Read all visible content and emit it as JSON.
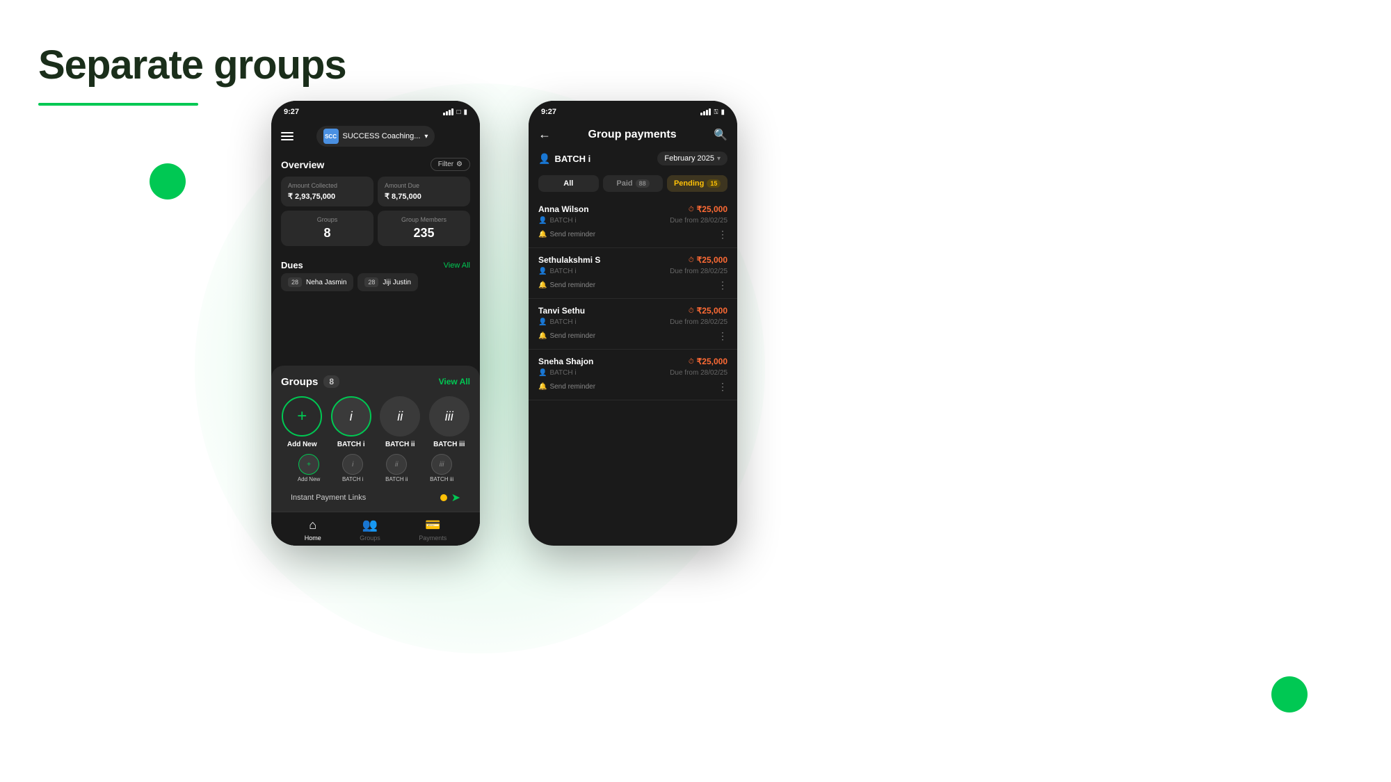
{
  "page": {
    "title": "Separate groups",
    "underline_color": "#00c853"
  },
  "left_phone": {
    "status_time": "9:27",
    "brand_name": "SUCCESS Coaching...",
    "brand_initials": "SCC",
    "header": {
      "filter_label": "Filter"
    },
    "overview": {
      "title": "Overview",
      "amount_collected_label": "Amount Collected",
      "amount_collected_value": "₹ 2,93,75,000",
      "amount_due_label": "Amount Due",
      "amount_due_value": "₹ 8,75,000",
      "groups_label": "Groups",
      "groups_value": "8",
      "members_label": "Group Members",
      "members_value": "235"
    },
    "dues": {
      "title": "Dues",
      "view_all": "View All",
      "items": [
        {
          "badge": "28",
          "name": "Neha Jasmin"
        },
        {
          "badge": "28",
          "name": "Jiji Justin"
        }
      ]
    },
    "groups_popup": {
      "title": "Groups",
      "count": "8",
      "view_all": "View All",
      "items": [
        {
          "icon": "+",
          "name": "Add New",
          "type": "add"
        },
        {
          "icon": "i",
          "name": "BATCH i",
          "type": "selected"
        },
        {
          "icon": "ii",
          "name": "BATCH ii",
          "type": "normal"
        },
        {
          "icon": "iii",
          "name": "BATCH iii",
          "type": "normal"
        }
      ]
    },
    "bottom_nav_small": {
      "items": [
        {
          "icon": "+",
          "label": "Add New"
        },
        {
          "icon": "i",
          "label": "BATCH i"
        },
        {
          "icon": "ii",
          "label": "BATCH ii"
        },
        {
          "icon": "iii",
          "label": "BATCH iii"
        }
      ]
    },
    "payment_links_label": "Instant Payment Links",
    "bottom_nav": {
      "tabs": [
        {
          "icon": "⌂",
          "label": "Home",
          "active": true
        },
        {
          "icon": "👥",
          "label": "Groups",
          "active": false
        },
        {
          "icon": "💳",
          "label": "Payments",
          "active": false
        }
      ]
    }
  },
  "right_phone": {
    "status_time": "9:27",
    "title": "Group payments",
    "batch_name": "BATCH i",
    "month_selector": "February 2025",
    "tabs": {
      "all": "All",
      "paid": "Paid",
      "paid_count": "88",
      "pending": "Pending",
      "pending_count": "15"
    },
    "payments": [
      {
        "name": "Anna Wilson",
        "batch": "BATCH i",
        "amount": "₹25,000",
        "due_date": "Due from 28/02/25",
        "action": "Send reminder"
      },
      {
        "name": "Sethulakshmi S",
        "batch": "BATCH i",
        "amount": "₹25,000",
        "due_date": "Due from 28/02/25",
        "action": "Send reminder"
      },
      {
        "name": "Tanvi Sethu",
        "batch": "BATCH i",
        "amount": "₹25,000",
        "due_date": "Due from 28/02/25",
        "action": "Send reminder"
      },
      {
        "name": "Sneha Shajon",
        "batch": "BATCH i",
        "amount": "₹25,000",
        "due_date": "Due from 28/02/25",
        "action": "Send reminder"
      }
    ]
  }
}
